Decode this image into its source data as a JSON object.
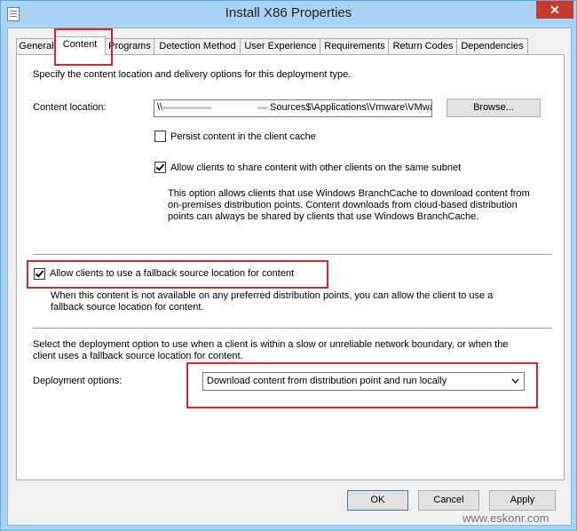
{
  "window": {
    "title": "Install X86 Properties",
    "close_glyph": "✕"
  },
  "tabs": [
    {
      "label": "General"
    },
    {
      "label": "Content"
    },
    {
      "label": "Programs"
    },
    {
      "label": "Detection Method"
    },
    {
      "label": "User Experience"
    },
    {
      "label": "Requirements"
    },
    {
      "label": "Return Codes"
    },
    {
      "label": "Dependencies"
    }
  ],
  "content": {
    "description": "Specify the content location and delivery options for this deployment type.",
    "location_label": "Content location:",
    "location_value_start": "\\\\",
    "location_value_end": "Sources$\\Applications\\Vmware\\VMware",
    "browse_label": "Browse...",
    "persist_label": "Persist content in the client cache",
    "persist_checked": false,
    "share_label": "Allow clients to share content with other clients on the same subnet",
    "share_checked": true,
    "branchcache_note": "This option allows clients that use Windows BranchCache to download content from on-premises distribution points. Content downloads from cloud-based distribution points can always be shared by clients that use Windows BranchCache.",
    "fallback_label": "Allow clients to use a fallback source location for content",
    "fallback_checked": true,
    "fallback_note": "When this content is not available on any preferred distribution points, you can allow the client to use a fallback source location for content.",
    "deploy_description": "Select the deployment option to use when a client is within a slow or unreliable network boundary, or when the client uses a fallback source location for content.",
    "deploy_label": "Deployment options:",
    "deploy_selected": "Download content from distribution point and run locally"
  },
  "footer": {
    "ok_label": "OK",
    "cancel_label": "Cancel",
    "apply_label": "Apply"
  },
  "watermark": "www.eskonr.com",
  "colors": {
    "highlight_red": "#d8262e",
    "title_bar": "#a9d3f4"
  }
}
